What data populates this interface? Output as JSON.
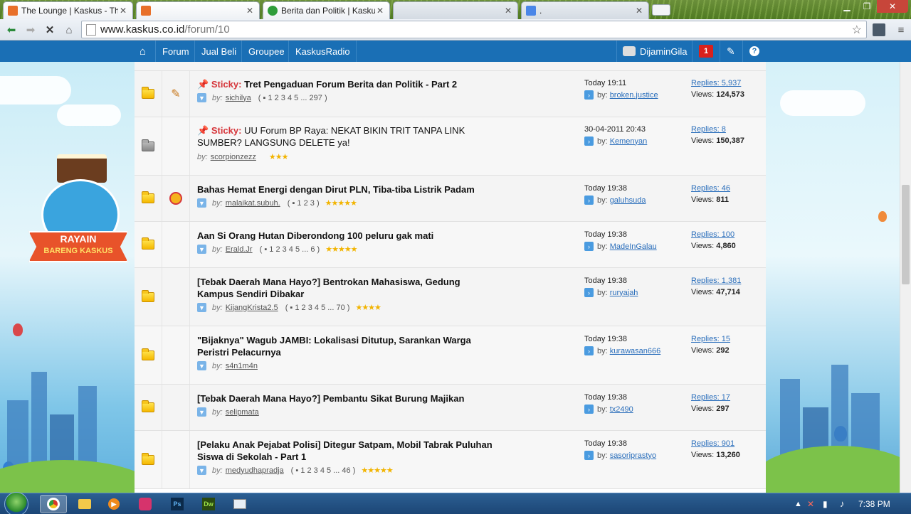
{
  "browser": {
    "tabs": [
      {
        "label": "The Lounge | Kaskus - The",
        "active": true
      },
      {
        "label": "",
        "active": false
      },
      {
        "label": "Berita dan Politik | Kaskus",
        "active": true
      },
      {
        "label": "",
        "active": false
      },
      {
        "label": ".",
        "active": false
      }
    ],
    "url_host": "www.kaskus.co.id",
    "url_path": "/forum/10"
  },
  "sitenav": {
    "items": [
      "Forum",
      "Jual Beli",
      "Groupee",
      "KaskusRadio"
    ],
    "username": "DijaminGila",
    "notification_count": "1"
  },
  "promo": {
    "line1": "RAYAIN",
    "line2": "BARENG KASKUS"
  },
  "threads": [
    {
      "sticky_label": "Sticky:",
      "title": "Tret Pengaduan Forum Berita dan Politik - Part 2",
      "by": "by:",
      "author": "sichilya",
      "pages": "1  2  3  4  5 ... 297",
      "stars": "",
      "last_time": "Today 19:11",
      "last_by": "broken.justice",
      "replies": "Replies: 5,937",
      "views_label": "Views:",
      "views": "124,573"
    },
    {
      "sticky_label": "Sticky:",
      "title": "UU Forum BP Raya: NEKAT BIKIN TRIT TANPA LINK SUMBER? LANGSUNG DELETE ya!",
      "by": "by:",
      "author": "scorpionzezz",
      "pages": "",
      "stars": "★★★",
      "last_time": "30-04-2011 20:43",
      "last_by": "Kemenyan",
      "replies": "Replies: 8",
      "views_label": "Views:",
      "views": "150,387"
    },
    {
      "sticky_label": "",
      "title": "Bahas Hemat Energi dengan Dirut PLN, Tiba-tiba Listrik Padam",
      "by": "by:",
      "author": "malaikat.subuh.",
      "pages": "1  2  3",
      "stars": "★★★★★",
      "last_time": "Today 19:38",
      "last_by": "galuhsuda",
      "replies": "Replies: 46",
      "views_label": "Views:",
      "views": "811"
    },
    {
      "sticky_label": "",
      "title": "Aan Si Orang Hutan Diberondong 100 peluru gak mati",
      "by": "by:",
      "author": "Erald.Jr",
      "pages": "1  2  3  4  5 ... 6",
      "stars": "★★★★★",
      "last_time": "Today 19:38",
      "last_by": "MadeInGalau",
      "replies": "Replies: 100",
      "views_label": "Views:",
      "views": "4,860"
    },
    {
      "sticky_label": "",
      "title": "[Tebak Daerah Mana Hayo?] Bentrokan Mahasiswa, Gedung Kampus Sendiri Dibakar",
      "by": "by:",
      "author": "KijangKrista2.5",
      "pages": "1  2  3  4  5 ... 70",
      "stars": "★★★★",
      "last_time": "Today 19:38",
      "last_by": "ruryajah",
      "replies": "Replies: 1,381",
      "views_label": "Views:",
      "views": "47,714"
    },
    {
      "sticky_label": "",
      "title": "\"Bijaknya\" Wagub JAMBI: Lokalisasi Ditutup, Sarankan Warga Peristri Pelacurnya",
      "by": "by:",
      "author": "s4n1m4n",
      "pages": "",
      "stars": "",
      "last_time": "Today 19:38",
      "last_by": "kurawasan666",
      "replies": "Replies: 15",
      "views_label": "Views:",
      "views": "292"
    },
    {
      "sticky_label": "",
      "title": "[Tebak Daerah Mana Hayo?] Pembantu Sikat Burung Majikan",
      "by": "by:",
      "author": "selipmata",
      "pages": "",
      "stars": "",
      "last_time": "Today 19:38",
      "last_by": "tx2490",
      "replies": "Replies: 17",
      "views_label": "Views:",
      "views": "297"
    },
    {
      "sticky_label": "",
      "title": "[Pelaku Anak Pejabat Polisi] Ditegur Satpam, Mobil Tabrak Puluhan Siswa di Sekolah - Part 1",
      "by": "by:",
      "author": "medyudhapradja",
      "pages": "1  2  3  4  5 ... 46",
      "stars": "★★★★★",
      "last_time": "Today 19:38",
      "last_by": "sasoriprastyo",
      "replies": "Replies: 901",
      "views_label": "Views:",
      "views": "13,260"
    }
  ],
  "taskbar": {
    "clock": "7:38 PM"
  },
  "colors": {
    "navbar": "#1a6fb5",
    "sticky": "#d6363b",
    "link": "#2a6ebb"
  }
}
